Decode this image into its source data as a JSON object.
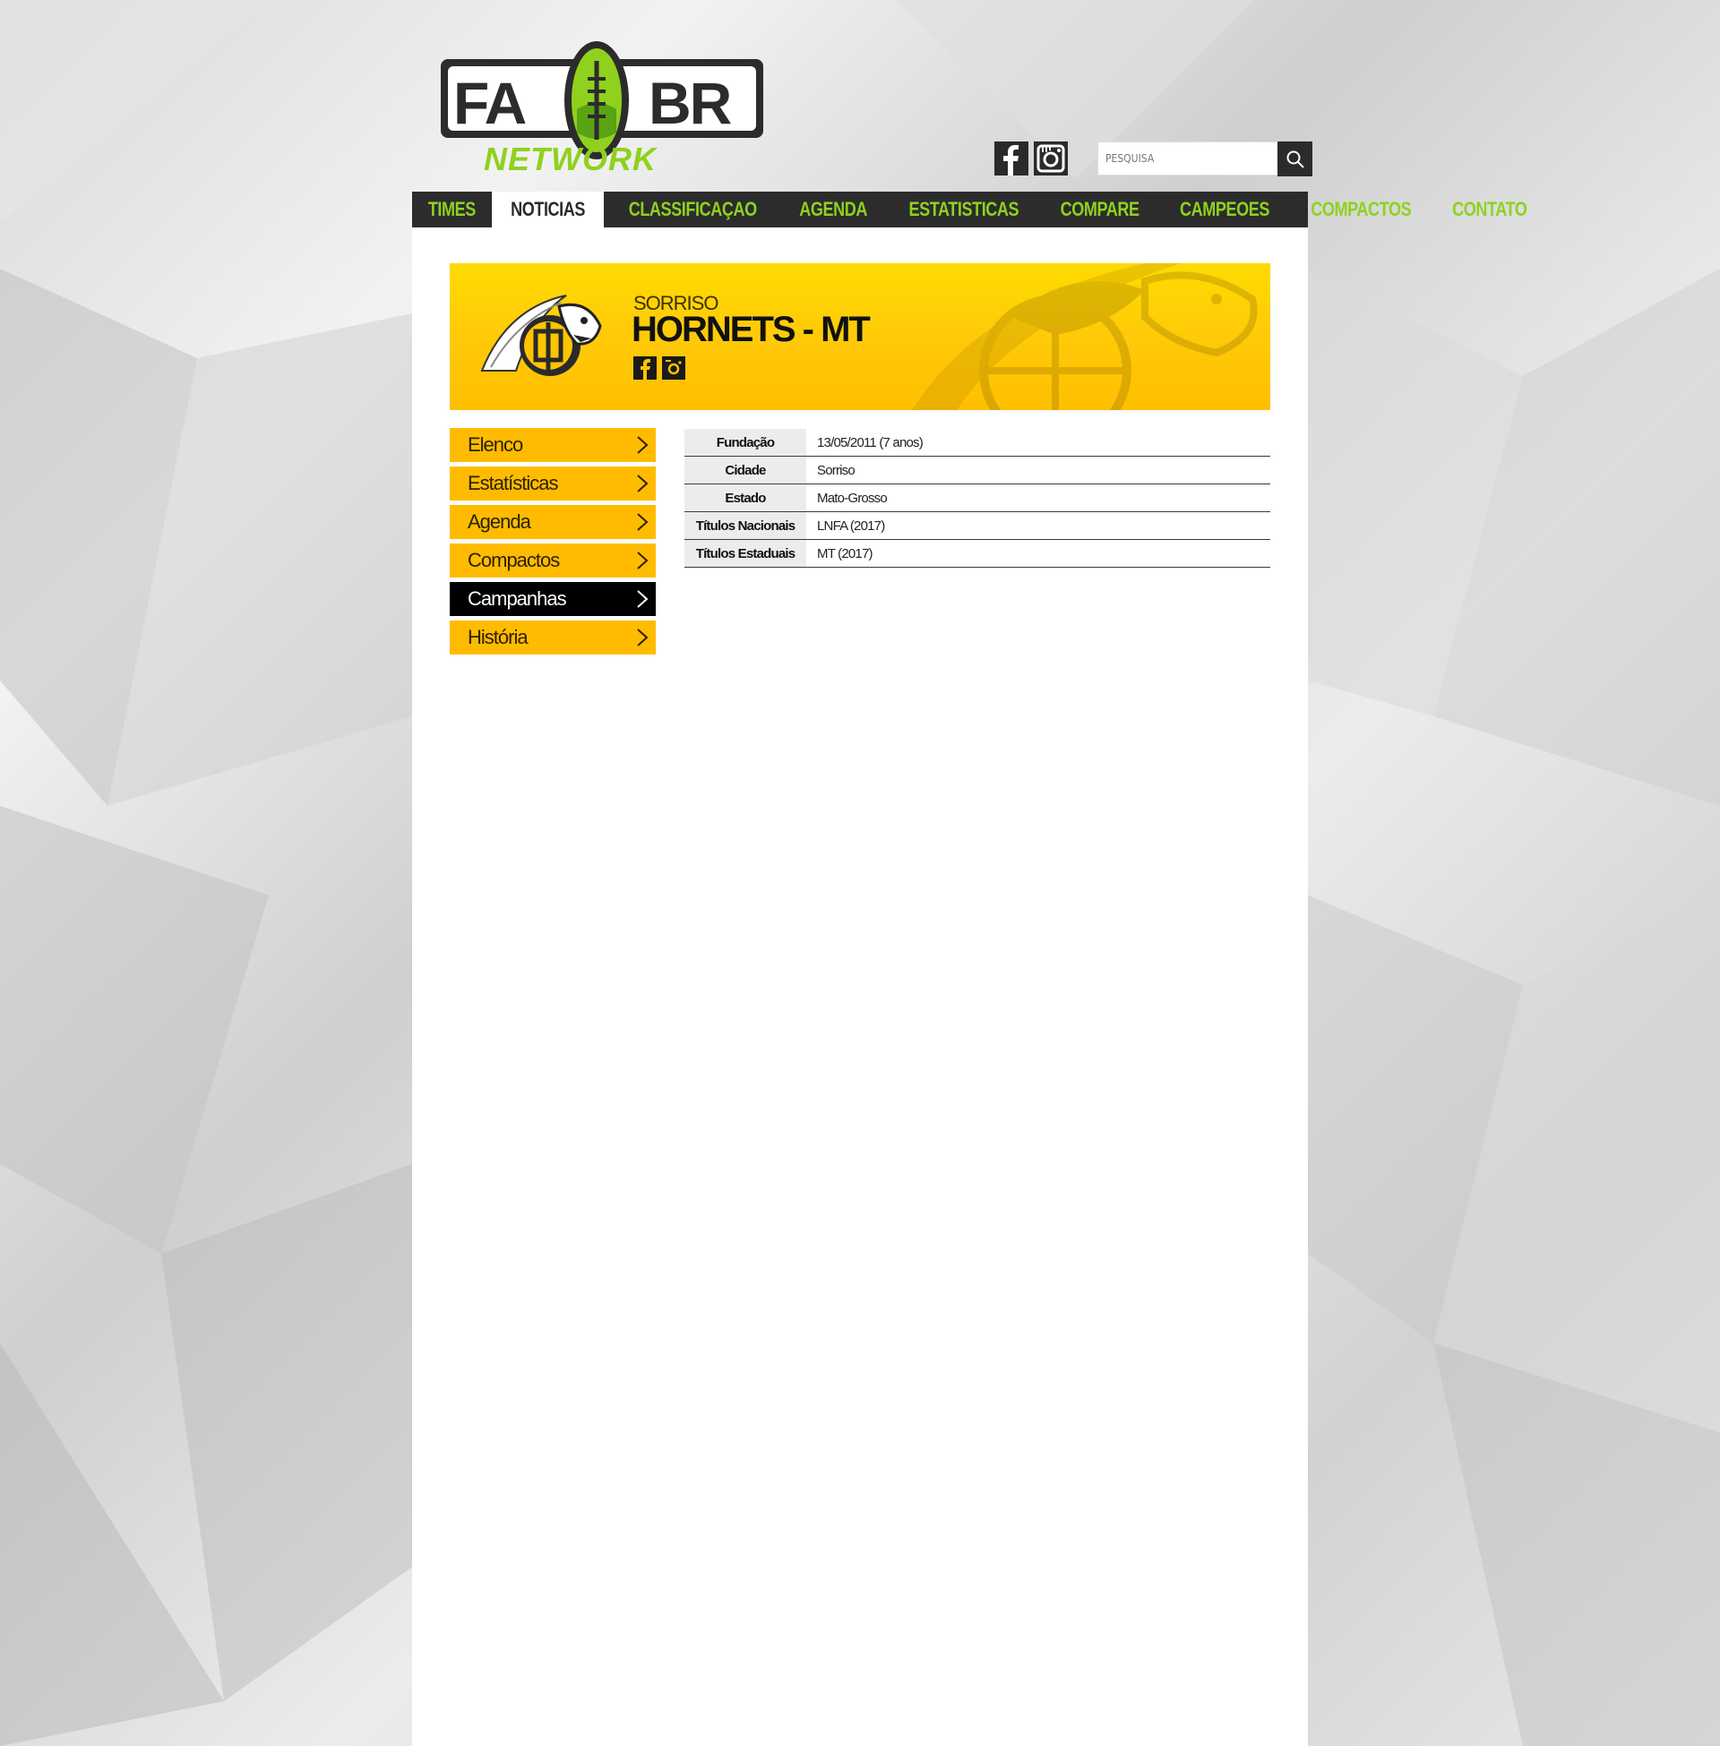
{
  "brand": {
    "logo_text_top_left": "FA",
    "logo_text_top_right": "BR",
    "logo_text_bottom": "NETWORK",
    "colors": {
      "green": "#8fd11e",
      "dark": "#2c2c2c",
      "yellow": "#ffbb00"
    }
  },
  "header": {
    "social": [
      {
        "name": "facebook-icon",
        "label": "f"
      },
      {
        "name": "instagram-icon",
        "label": ""
      }
    ],
    "search": {
      "placeholder": "PESQUISA",
      "icon": "search-icon"
    }
  },
  "nav": {
    "items": [
      {
        "label": "TIMES",
        "active": false
      },
      {
        "label": "NOTICIAS",
        "active": true
      },
      {
        "label": "CLASSIFICAÇAO",
        "active": false
      },
      {
        "label": "AGENDA",
        "active": false
      },
      {
        "label": "ESTATISTICAS",
        "active": false
      },
      {
        "label": "COMPARE",
        "active": false
      },
      {
        "label": "CAMPEOES",
        "active": false
      },
      {
        "label": "COMPACTOS",
        "active": false
      },
      {
        "label": "CONTATO",
        "active": false
      }
    ]
  },
  "team": {
    "city": "SORRISO",
    "name": "HORNETS - MT"
  },
  "sidebar": {
    "items": [
      {
        "label": "Elenco",
        "active": false
      },
      {
        "label": "Estatísticas",
        "active": false
      },
      {
        "label": "Agenda",
        "active": false
      },
      {
        "label": "Compactos",
        "active": false
      },
      {
        "label": "Campanhas",
        "active": true
      },
      {
        "label": "História",
        "active": false
      }
    ]
  },
  "info": {
    "rows": [
      {
        "key": "Fundação",
        "value": "13/05/2011  (7 anos)"
      },
      {
        "key": "Cidade",
        "value": "Sorriso"
      },
      {
        "key": "Estado",
        "value": "Mato-Grosso"
      },
      {
        "key": "Títulos Nacionais",
        "value": "LNFA (2017)"
      },
      {
        "key": "Títulos Estaduais",
        "value": "MT (2017)"
      }
    ]
  }
}
